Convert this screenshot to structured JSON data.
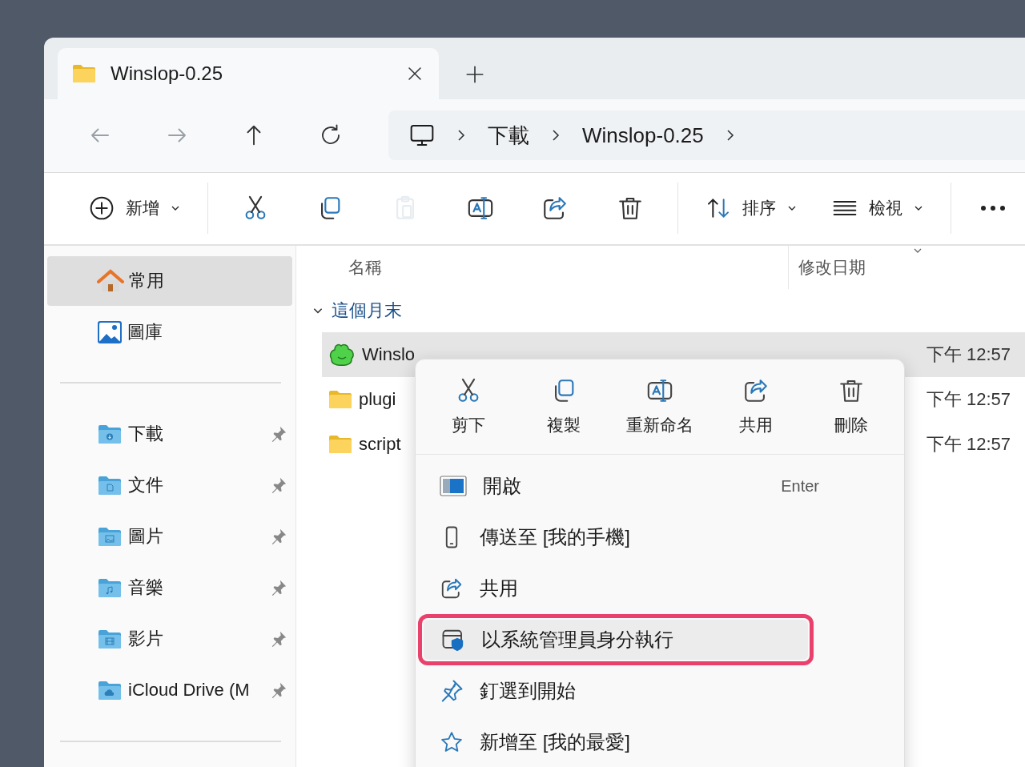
{
  "tab": {
    "title": "Winslop-0.25",
    "selected": true
  },
  "nav": [
    {
      "kind": "back",
      "disabled": true
    },
    {
      "kind": "forward",
      "disabled": true
    },
    {
      "kind": "up",
      "disabled": false
    },
    {
      "kind": "refresh",
      "disabled": false
    }
  ],
  "breadcrumb": [
    "下載",
    "Winslop-0.25"
  ],
  "toolbar": [
    [
      {
        "kind": "new",
        "label": "新增",
        "disabled": false
      }
    ],
    [
      {
        "kind": "cut",
        "disabled": false
      },
      {
        "kind": "copy",
        "disabled": false
      },
      {
        "kind": "paste",
        "disabled": true
      },
      {
        "kind": "rename",
        "disabled": false
      },
      {
        "kind": "share",
        "disabled": false
      },
      {
        "kind": "delete",
        "disabled": false
      }
    ],
    [
      {
        "kind": "sort",
        "label": "排序",
        "disabled": false
      },
      {
        "kind": "view",
        "label": "檢視",
        "disabled": false
      }
    ],
    [
      {
        "kind": "more",
        "disabled": false
      }
    ]
  ],
  "sidebar": {
    "top": [
      {
        "kind": "home",
        "label": "常用",
        "selected": true
      },
      {
        "kind": "gallery",
        "label": "圖庫",
        "selected": false
      }
    ],
    "pinned": [
      {
        "kind": "download",
        "label": "下載",
        "pinned": true,
        "selected": false
      },
      {
        "kind": "document",
        "label": "文件",
        "pinned": true,
        "selected": false
      },
      {
        "kind": "image",
        "label": "圖片",
        "pinned": true,
        "selected": false
      },
      {
        "kind": "music",
        "label": "音樂",
        "pinned": true,
        "selected": false
      },
      {
        "kind": "video",
        "label": "影片",
        "pinned": true,
        "selected": false
      },
      {
        "kind": "cloud",
        "label": "iCloud Drive (M",
        "pinned": true,
        "selected": false
      }
    ]
  },
  "columns": [
    "名稱",
    "修改日期"
  ],
  "group": {
    "label": "這個月末",
    "expanded": true
  },
  "files": [
    {
      "kind": "app",
      "name": "Winslo",
      "date": "下午 12:57",
      "selected": true
    },
    {
      "kind": "folder",
      "name": "plugi",
      "date": "下午 12:57",
      "selected": false
    },
    {
      "kind": "folder",
      "name": "script",
      "date": "下午 12:57",
      "selected": false
    }
  ],
  "context_menu": {
    "actions": [
      {
        "kind": "cut",
        "label": "剪下"
      },
      {
        "kind": "copy",
        "label": "複製"
      },
      {
        "kind": "rename",
        "label": "重新命名"
      },
      {
        "kind": "share",
        "label": "共用"
      },
      {
        "kind": "delete",
        "label": "刪除"
      }
    ],
    "items": [
      {
        "kind": "open",
        "label": "開啟",
        "shortcut": "Enter",
        "selected": false
      },
      {
        "kind": "phone",
        "label": "傳送至 [我的手機]",
        "selected": false
      },
      {
        "kind": "share",
        "label": "共用",
        "selected": false
      },
      {
        "kind": "admin",
        "label": "以系統管理員身分執行",
        "selected": true
      },
      {
        "kind": "pin",
        "label": "釘選到開始",
        "selected": false
      },
      {
        "kind": "star",
        "label": "新增至 [我的最愛]",
        "selected": false
      }
    ]
  }
}
